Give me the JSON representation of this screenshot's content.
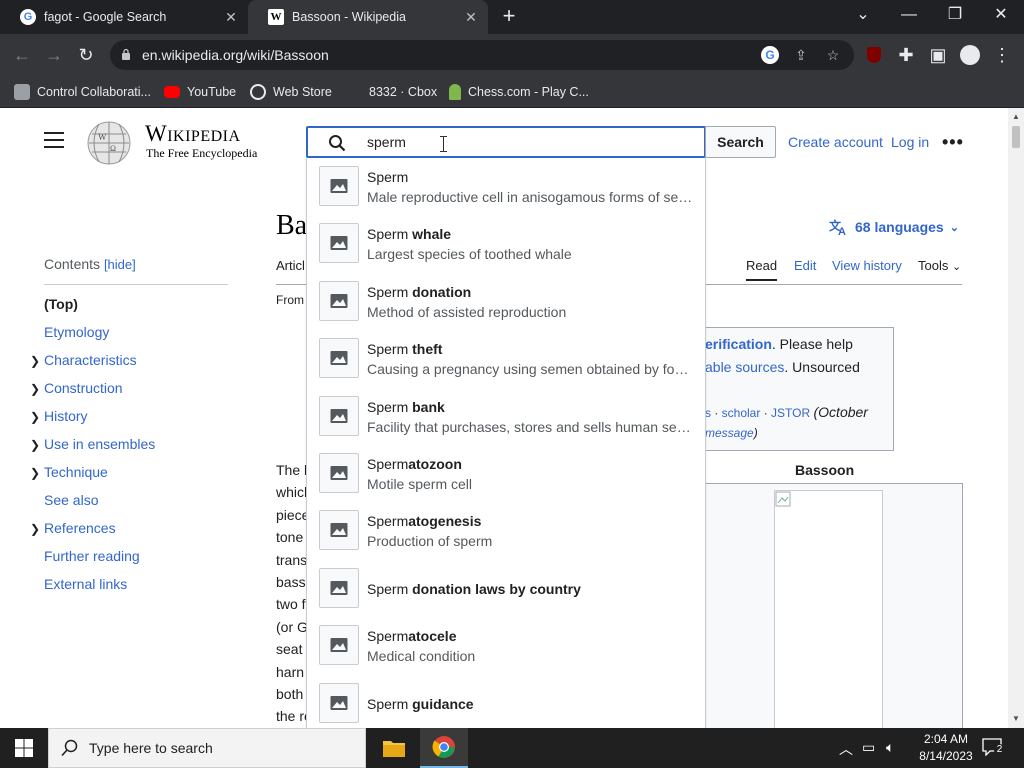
{
  "browser": {
    "tabs": [
      {
        "title": "fagot - Google Search",
        "favicon": "google-icon"
      },
      {
        "title": "Bassoon - Wikipedia",
        "favicon": "wikipedia-icon"
      }
    ],
    "url": "en.wikipedia.org/wiki/Bassoon",
    "bookmarks": [
      {
        "label": "Control Collaborati...",
        "icon": "extension-puzzle-icon"
      },
      {
        "label": "YouTube",
        "icon": "youtube-icon"
      },
      {
        "label": "Web Store",
        "icon": "web-store-icon"
      },
      {
        "label": "8332 · Cbox",
        "icon": "cbox-icon"
      },
      {
        "label": "Chess.com - Play C...",
        "icon": "chess-pawn-icon"
      }
    ]
  },
  "wiki": {
    "wordmark": "Wikipedia",
    "tagline": "The Free Encyclopedia",
    "search_value": "sperm",
    "search_button": "Search",
    "create_account": "Create account",
    "log_in": "Log in",
    "more": "•••",
    "article_title": "Ba",
    "languages": "68 languages",
    "tab_article": "Articl",
    "tabs_right": [
      "Read",
      "Edit",
      "View history",
      "Tools"
    ],
    "from_text": "From",
    "toc": {
      "heading": "Contents",
      "hide": "[hide]",
      "items": [
        {
          "label": "(Top)",
          "expandable": false
        },
        {
          "label": "Etymology",
          "expandable": false
        },
        {
          "label": "Characteristics",
          "expandable": true
        },
        {
          "label": "Construction",
          "expandable": true
        },
        {
          "label": "History",
          "expandable": true
        },
        {
          "label": "Use in ensembles",
          "expandable": true
        },
        {
          "label": "Technique",
          "expandable": true
        },
        {
          "label": "See also",
          "expandable": false
        },
        {
          "label": "References",
          "expandable": true
        },
        {
          "label": "Further reading",
          "expandable": false
        },
        {
          "label": "External links",
          "expandable": false
        }
      ]
    },
    "body_fragments": [
      "The b",
      "which",
      "piece",
      "tone",
      "trans",
      "bass",
      "two f",
      "(or G",
      "seat",
      "harn",
      "both",
      "the re"
    ],
    "ambox": {
      "line1_link": "erification",
      "line1_rest": ". Please help",
      "line2_link": "able sources",
      "line2_rest": ". Unsourced",
      "line3_s": "s",
      "line3_scholar": "scholar",
      "line3_jstor": "JSTOR",
      "line3_date": "(October",
      "line4_link": "message",
      "line4_rest": ")"
    },
    "infobox_title": "Bassoon"
  },
  "suggestions": [
    {
      "prefix": "Sperm",
      "suffix": "",
      "desc": "Male reproductive cell in anisogamous forms of sexual reproduction"
    },
    {
      "prefix": "Sperm",
      "suffix": " whale",
      "desc": "Largest species of toothed whale"
    },
    {
      "prefix": "Sperm",
      "suffix": " donation",
      "desc": "Method of assisted reproduction"
    },
    {
      "prefix": "Sperm",
      "suffix": " theft",
      "desc": "Causing a pregnancy using semen obtained by fortuitous means"
    },
    {
      "prefix": "Sperm",
      "suffix": " bank",
      "desc": "Facility that purchases, stores and sells human semen"
    },
    {
      "prefix": "Sperm",
      "suffix": "atozoon",
      "desc": "Motile sperm cell"
    },
    {
      "prefix": "Sperm",
      "suffix": "atogenesis",
      "desc": "Production of sperm"
    },
    {
      "prefix": "Sperm",
      "suffix": " donation laws by country",
      "desc": ""
    },
    {
      "prefix": "Sperm",
      "suffix": "atocele",
      "desc": "Medical condition"
    },
    {
      "prefix": "Sperm",
      "suffix": " guidance",
      "desc": ""
    }
  ],
  "taskbar": {
    "search_placeholder": "Type here to search",
    "time": "2:04 AM",
    "date": "8/14/2023",
    "notifications": "2"
  },
  "colors": {
    "link": "#3366cc",
    "chrome_dark": "#202124",
    "chrome_tab": "#35363a"
  }
}
